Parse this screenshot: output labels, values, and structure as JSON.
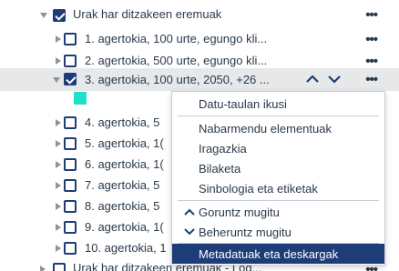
{
  "tree": {
    "parent_label": "Urak har ditzakeen eremuak",
    "more_label": "•••",
    "items": [
      {
        "label": "1. agertokia, 100 urte, egungo kli..."
      },
      {
        "label": "2. agertokia, 500 urte, egungo kli..."
      },
      {
        "label": "3. agertokia, 100 urte, 2050, +26 ..."
      },
      {
        "label": "4. agertokia, 5"
      },
      {
        "label": "5. agertokia, 1("
      },
      {
        "label": "6. agertokia, 1("
      },
      {
        "label": "7. agertokia, 5"
      },
      {
        "label": "8. agertokia, 5"
      },
      {
        "label": "9. agertokia, 1("
      },
      {
        "label": "10. agertokia, 1"
      }
    ],
    "next_group_label": "Urak har ditzakeen eremuak - Lod...",
    "move_up_icon": "chevron-up-icon",
    "move_down_icon": "chevron-down-icon",
    "swatch_color": "#22e0c8"
  },
  "context_menu": {
    "items": [
      {
        "label": "Datu-taulan ikusi"
      },
      {
        "label": "Nabarmendu elementuak"
      },
      {
        "label": "Iragazkia"
      },
      {
        "label": "Bilaketa"
      },
      {
        "label": "Sinbologia eta etiketak"
      },
      {
        "label": "Goruntz mugitu",
        "icon": "chevron-up-icon",
        "glyph": "^"
      },
      {
        "label": "Beheruntz mugitu",
        "icon": "chevron-down-icon",
        "glyph": "v"
      },
      {
        "label": "Metadatuak eta deskargak",
        "highlighted": true
      }
    ]
  },
  "colors": {
    "accent": "#1d3c78",
    "selected_row_bg": "#e7e8ea",
    "text": "#2b3a4a"
  }
}
